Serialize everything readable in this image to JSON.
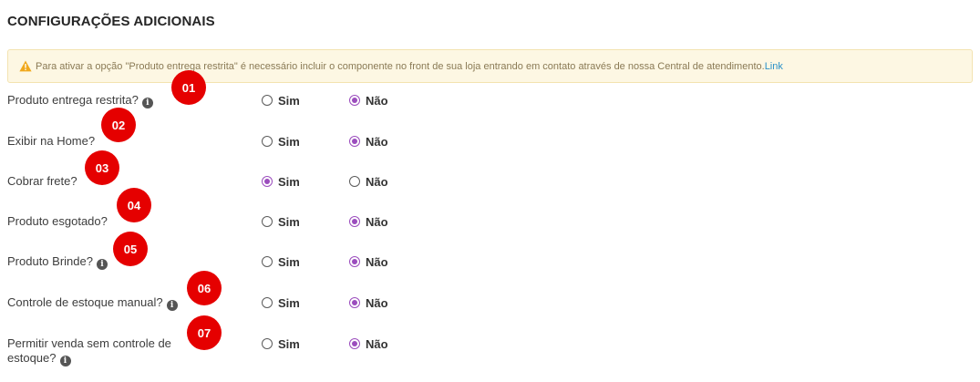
{
  "section_title": "CONFIGURAÇÕES ADICIONAIS",
  "alert": {
    "icon": "warning-icon",
    "text": "Para ativar a opção \"Produto entrega restrita\" é necessário incluir o componente no front de sua loja entrando em contato através de nossa Central de atendimento.",
    "link": "Link"
  },
  "colors": {
    "accent": "#9b4dbd",
    "marker": "#e50000",
    "link": "#2a90c8"
  },
  "options": {
    "yes": "Sim",
    "no": "Não"
  },
  "rows": [
    {
      "label": "Produto entrega restrita?",
      "info": true,
      "marker": "01",
      "selected": "no"
    },
    {
      "label": "Exibir na Home?",
      "info": false,
      "marker": "02",
      "selected": "no"
    },
    {
      "label": "Cobrar frete?",
      "info": false,
      "marker": "03",
      "selected": "yes"
    },
    {
      "label": "Produto esgotado?",
      "info": false,
      "marker": "04",
      "selected": "no"
    },
    {
      "label": "Produto Brinde?",
      "info": true,
      "marker": "05",
      "selected": "no"
    },
    {
      "label": "Controle de estoque manual?",
      "info": true,
      "marker": "06",
      "selected": "no"
    },
    {
      "label": "Permitir venda sem controle de estoque?",
      "info": true,
      "marker": "07",
      "selected": "no"
    }
  ]
}
